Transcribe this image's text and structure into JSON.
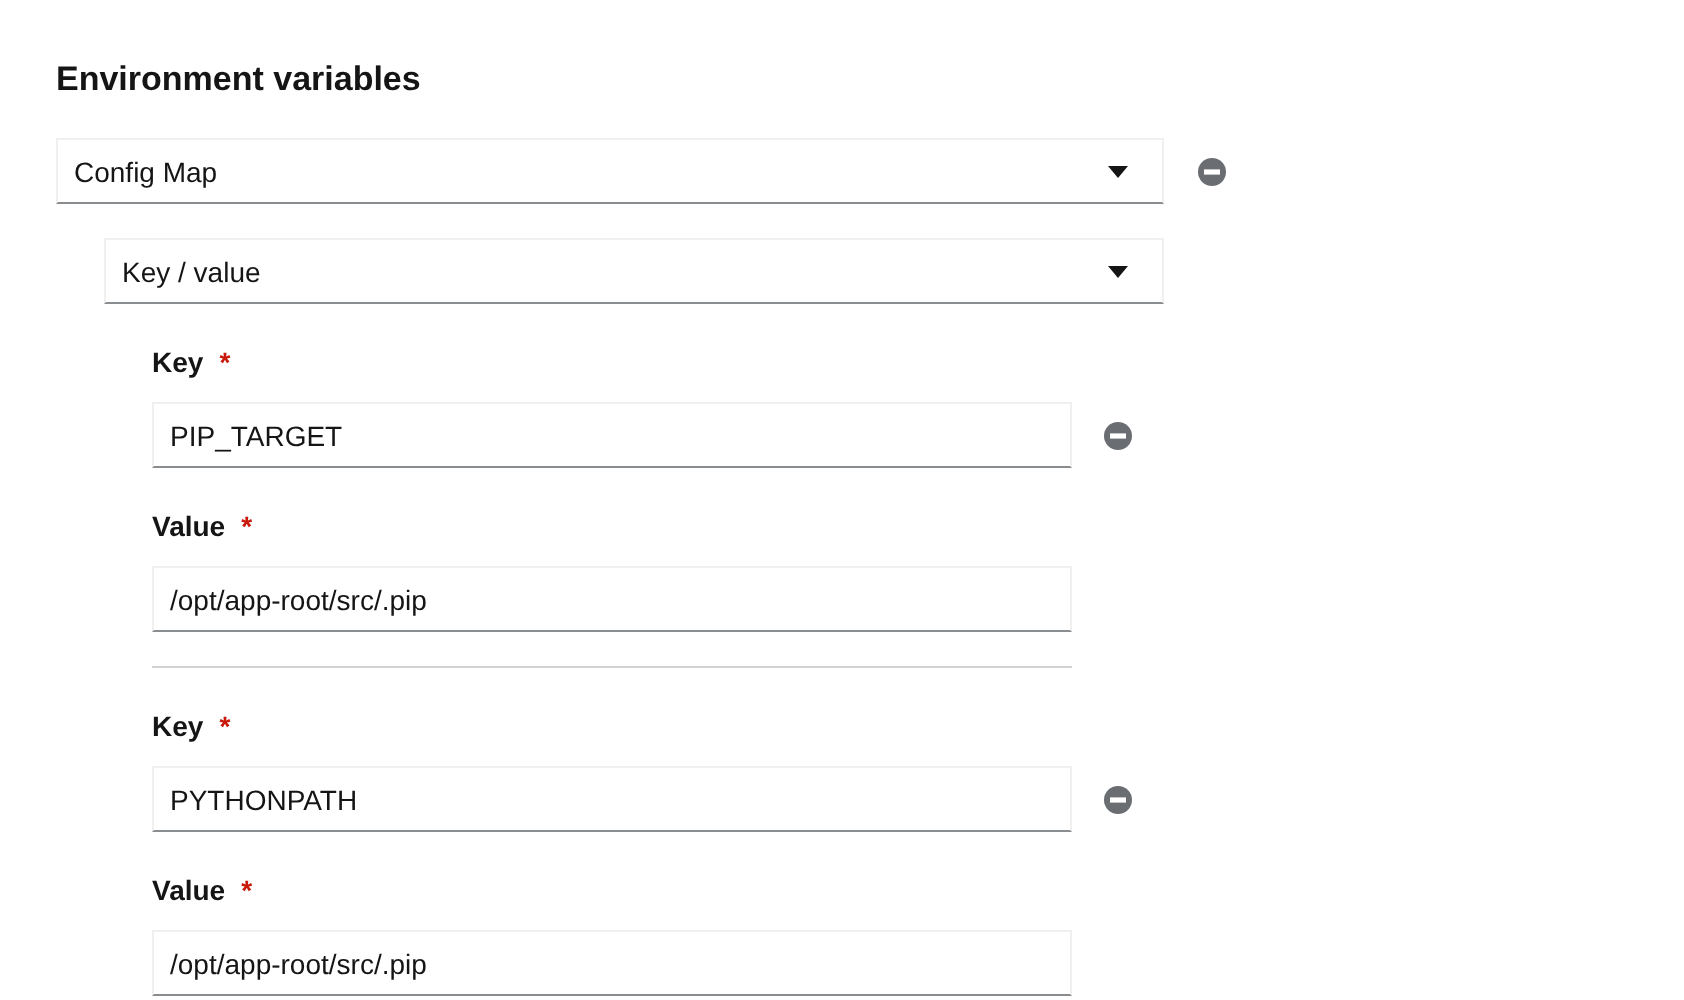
{
  "heading": "Environment variables",
  "source_select": {
    "value": "Config Map"
  },
  "type_select": {
    "value": "Key / value"
  },
  "pairs": [
    {
      "key": {
        "label": "Key",
        "required_mark": "*",
        "value": "PIP_TARGET"
      },
      "value": {
        "label": "Value",
        "required_mark": "*",
        "value": "/opt/app-root/src/.pip"
      }
    },
    {
      "key": {
        "label": "Key",
        "required_mark": "*",
        "value": "PYTHONPATH"
      },
      "value": {
        "label": "Value",
        "required_mark": "*",
        "value": "/opt/app-root/src/.pip"
      }
    }
  ]
}
